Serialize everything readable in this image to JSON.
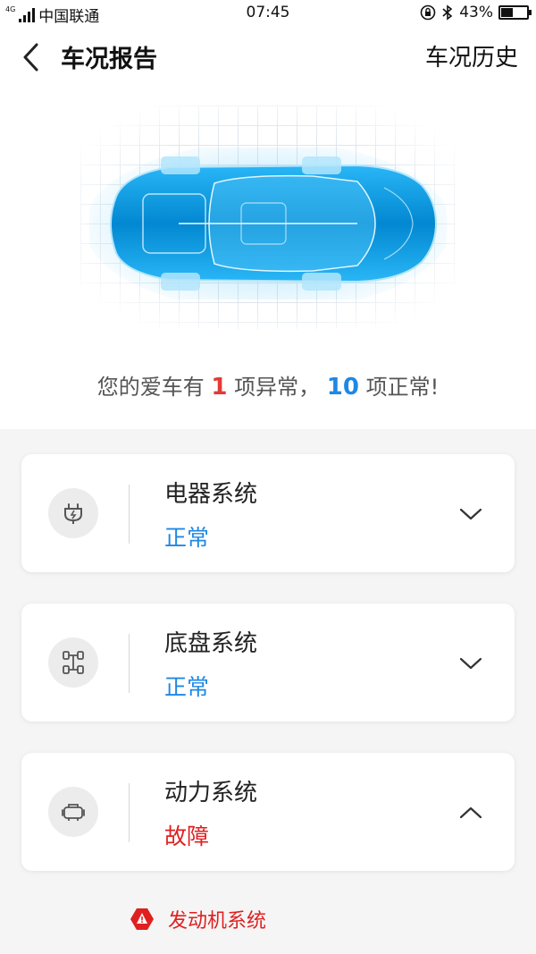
{
  "status_bar": {
    "network": "4G",
    "carrier": "中国联通",
    "time": "07:45",
    "battery": "43%",
    "battery_level": 0.43
  },
  "header": {
    "title": "车况报告",
    "history_label": "车况历史"
  },
  "summary": {
    "prefix": "您的爱车有",
    "abnormal_count": "1",
    "middle": "项异常，",
    "normal_count": "10",
    "suffix": "项正常!"
  },
  "systems": [
    {
      "name": "电器系统",
      "status": "正常",
      "icon": "electric-plug-icon",
      "expanded": false
    },
    {
      "name": "底盘系统",
      "status": "正常",
      "icon": "chassis-icon",
      "expanded": false
    },
    {
      "name": "动力系统",
      "status": "故障",
      "icon": "engine-icon",
      "expanded": true
    }
  ],
  "fault_items": [
    {
      "label": "发动机系统",
      "icon": "warning-icon"
    }
  ],
  "colors": {
    "normal": "#1e88e5",
    "fault": "#e02020",
    "car_glow": "#29b6f6"
  }
}
